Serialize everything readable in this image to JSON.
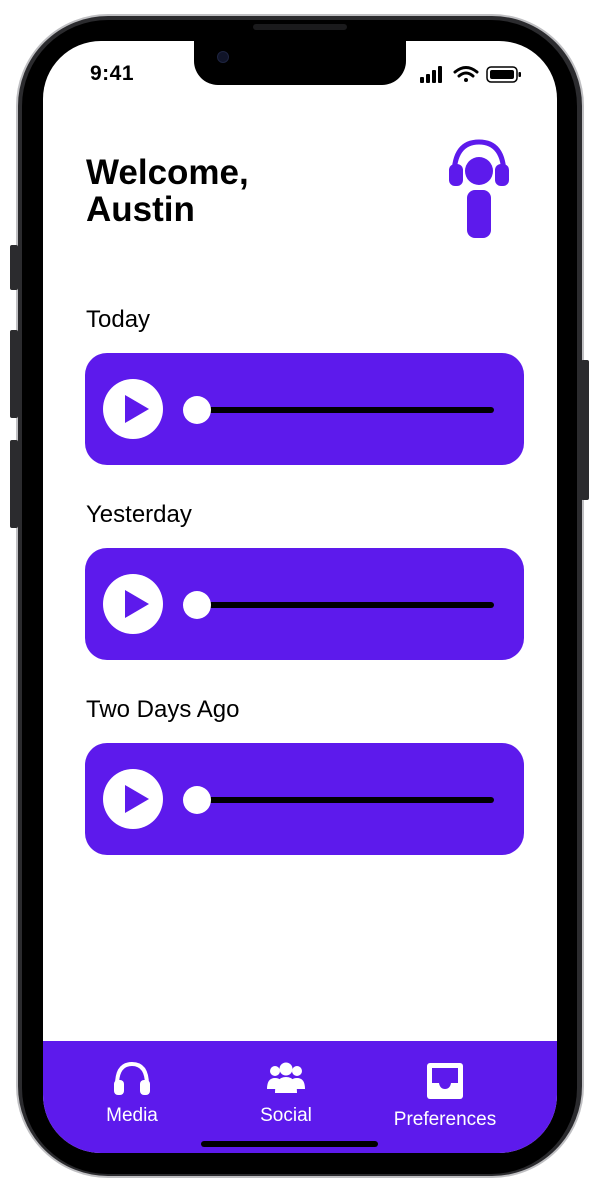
{
  "theme": {
    "accent": "#5d1aec",
    "background": "#ffffff"
  },
  "status_bar": {
    "time": "9:41",
    "icons": [
      "cellular-signal-icon",
      "wifi-icon",
      "battery-icon"
    ]
  },
  "header": {
    "greeting_line1": "Welcome,",
    "greeting_line2": "Austin",
    "logo_icon": "headphones-person-logo"
  },
  "recordings": [
    {
      "label": "Today",
      "progress": 0
    },
    {
      "label": "Yesterday",
      "progress": 0
    },
    {
      "label": "Two Days Ago",
      "progress": 0
    }
  ],
  "tab_bar": {
    "items": [
      {
        "label": "Media",
        "icon": "headphones-icon"
      },
      {
        "label": "Social",
        "icon": "group-icon"
      },
      {
        "label": "Preferences",
        "icon": "inbox-icon"
      }
    ]
  }
}
